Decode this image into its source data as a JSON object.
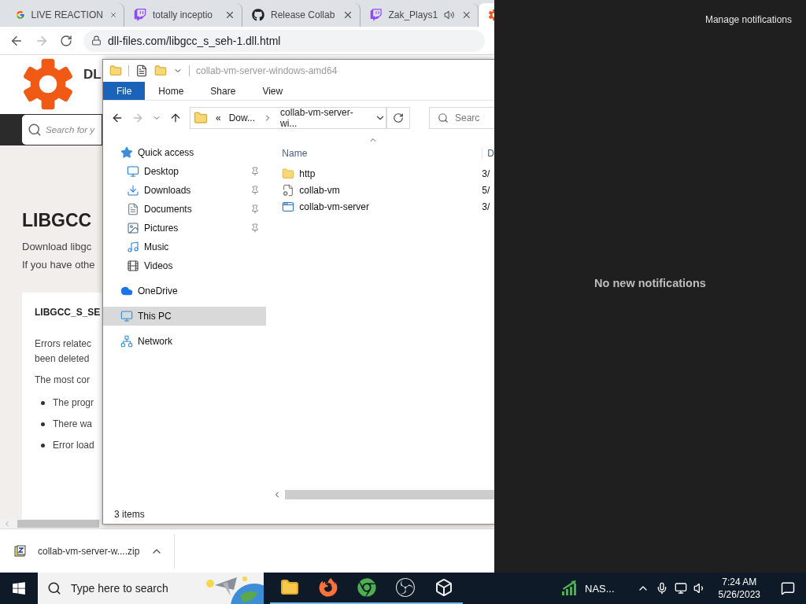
{
  "browser": {
    "tabs": [
      {
        "title": "LIVE REACTION",
        "kind": "google",
        "selected": false,
        "audio": false
      },
      {
        "title": "totally inceptio",
        "kind": "twitch",
        "selected": false,
        "audio": false
      },
      {
        "title": "Release Collab",
        "kind": "github",
        "selected": false,
        "audio": false
      },
      {
        "title": "Zak_Plays1",
        "kind": "twitch",
        "selected": false,
        "audio": true
      },
      {
        "kind": "gear",
        "selected": true,
        "audio": false
      }
    ],
    "url": "dll-files.com/libgcc_s_seh-1.dll.html",
    "page": {
      "site_name": "DL",
      "search_placeholder": "Search for y",
      "heading": "LIBGCC",
      "intro": [
        "Download libgc",
        "If you have othe"
      ],
      "card": {
        "title": "LIBGCC_S_SE",
        "lines": [
          "Errors relatec",
          "been deleted"
        ],
        "lead": "The most cor",
        "bullets": [
          "The progr",
          "There wa",
          "Error load"
        ]
      }
    },
    "download": {
      "filename": "collab-vm-server-w....zip"
    }
  },
  "explorer": {
    "title": "collab-vm-server-windows-amd64",
    "ribbon_tabs": [
      {
        "label": "File",
        "selected": true
      },
      {
        "label": "Home",
        "selected": false
      },
      {
        "label": "Share",
        "selected": false
      },
      {
        "label": "View",
        "selected": false
      }
    ],
    "path_overflow": "«",
    "path": [
      "Dow...",
      "collab-vm-server-wi..."
    ],
    "search_placeholder": "Searc",
    "nav": [
      {
        "label": "Quick access",
        "kind": "star",
        "selected": false,
        "children": [
          {
            "label": "Desktop",
            "kind": "desktop",
            "pinned": true,
            "selected": false
          },
          {
            "label": "Downloads",
            "kind": "download",
            "pinned": true,
            "selected": false
          },
          {
            "label": "Documents",
            "kind": "document",
            "pinned": true,
            "selected": false
          },
          {
            "label": "Pictures",
            "kind": "pictures",
            "pinned": true,
            "selected": false
          },
          {
            "label": "Music",
            "kind": "music",
            "pinned": false,
            "selected": false
          },
          {
            "label": "Videos",
            "kind": "video",
            "pinned": false,
            "selected": false
          }
        ]
      },
      {
        "label": "OneDrive",
        "kind": "cloud",
        "selected": false
      },
      {
        "label": "This PC",
        "kind": "pc",
        "selected": true
      },
      {
        "label": "Network",
        "kind": "network",
        "selected": false
      }
    ],
    "columns": [
      "Name",
      "D"
    ],
    "files": [
      {
        "name": "http",
        "kind": "folder",
        "column_2": "3/"
      },
      {
        "name": "collab-vm",
        "kind": "config",
        "column_2": "5/"
      },
      {
        "name": "collab-vm-server",
        "kind": "app",
        "column_2": "3/"
      }
    ],
    "status": "3 items"
  },
  "notifications": {
    "manage": "Manage notifications",
    "empty": "No new notifications"
  },
  "taskbar": {
    "search_placeholder": "Type here to search",
    "apps": [
      {
        "kind": "folder",
        "running": true
      },
      {
        "kind": "firefox",
        "running": true
      },
      {
        "kind": "chrome",
        "running": true
      },
      {
        "kind": "obs",
        "running": true
      },
      {
        "kind": "cube",
        "running": true
      }
    ],
    "tray_app": "NAS...",
    "time": "7:24 AM",
    "date": "5/26/2023"
  }
}
